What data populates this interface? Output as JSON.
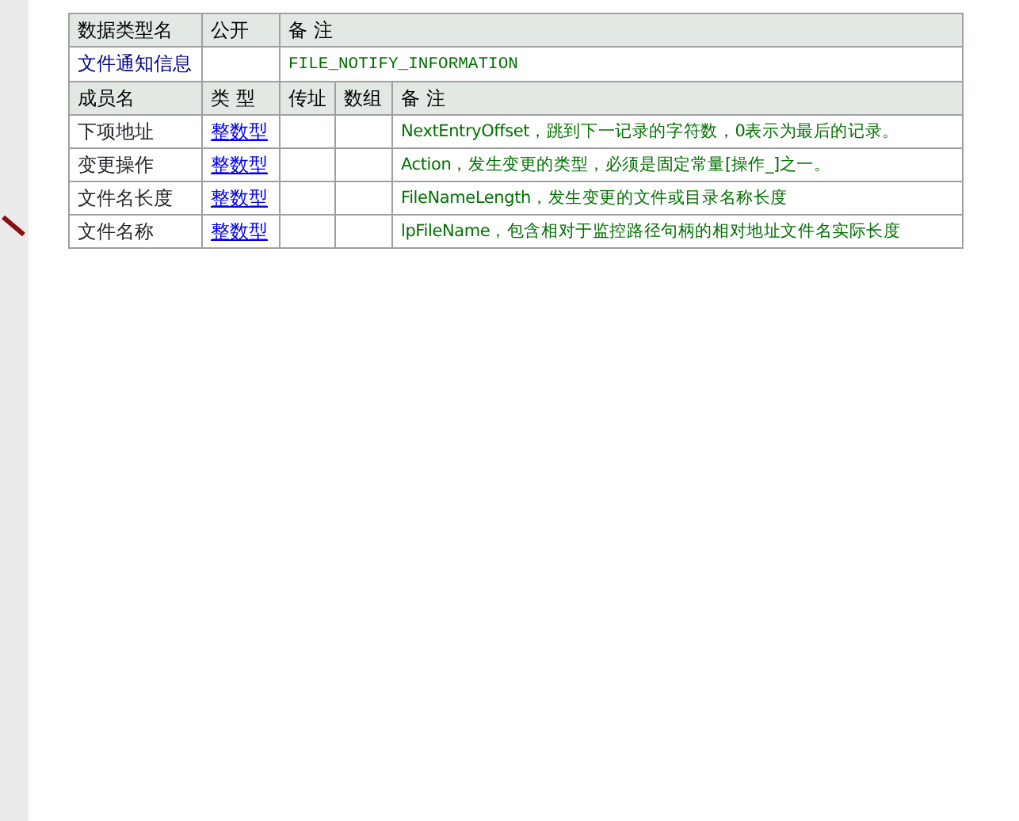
{
  "type_header": [
    "数据类型名",
    "公开",
    "备 注"
  ],
  "type_row": {
    "name": "文件通知信息",
    "note": "FILE_NOTIFY_INFORMATION"
  },
  "member_header": [
    "成员名",
    "类 型",
    "传址",
    "数组",
    "备 注"
  ],
  "members": [
    {
      "name": "下项地址",
      "type": "整数型",
      "note": "NextEntryOffset，跳到下一记录的字符数，0表示为最后的记录。"
    },
    {
      "name": "变更操作",
      "type": "整数型",
      "note": "Action，发生变更的类型，必须是固定常量[操作_]之一。"
    },
    {
      "name": "文件名长度",
      "type": "整数型",
      "note": "FileNameLength，发生变更的文件或目录名称长度"
    },
    {
      "name": "文件名称",
      "type": "整数型",
      "note": "lpFileName，包含相对于监控路径句柄的相对地址文件名实际长度"
    }
  ]
}
